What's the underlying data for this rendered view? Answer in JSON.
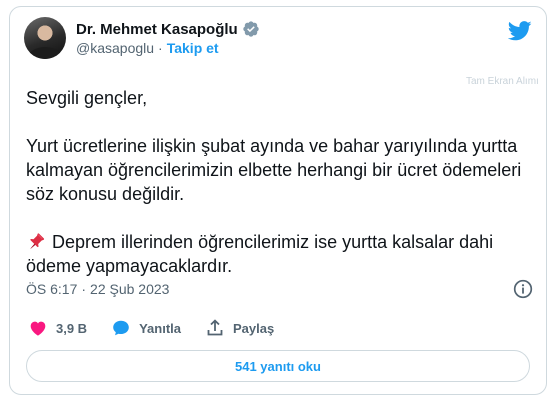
{
  "author": {
    "name": "Dr. Mehmet Kasapoğlu",
    "handle": "@kasapoglu",
    "separator": "·",
    "follow_label": "Takip et"
  },
  "fullscreen_hint": "Tam Ekran Alımı",
  "tweet": {
    "paragraphs": [
      "Sevgili gençler,",
      "Yurt ücretlerine ilişkin şubat ayında ve bahar yarıyılında yurtta kalmayan öğrencilerimizin elbette herhangi bir ücret ödemeleri söz konusu değildir.",
      "Deprem illerinden öğrencilerimiz ise yurtta kalsalar dahi ödeme yapmayacaklardır."
    ],
    "pin_icon": "pushpin-icon"
  },
  "meta": {
    "time": "ÖS 6:17",
    "separator": "·",
    "date": "22 Şub 2023"
  },
  "actions": {
    "likes": "3,9 B",
    "reply_label": "Yanıtla",
    "share_label": "Paylaş"
  },
  "read_replies_label": "541 yanıtı oku",
  "colors": {
    "accent": "#1d9bf0",
    "like": "#f91880",
    "text": "#0f1419",
    "secondary": "#536471",
    "border": "#cfd9de"
  }
}
